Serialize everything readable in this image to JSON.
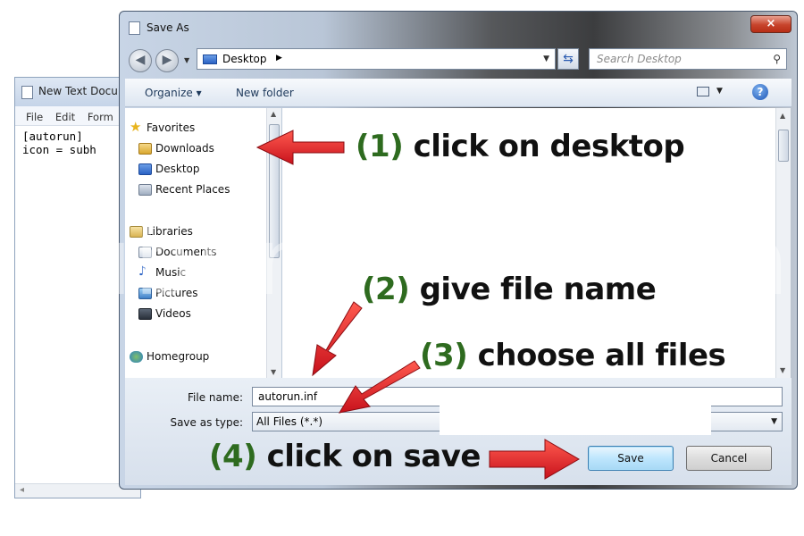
{
  "notepad": {
    "title": "New Text Docu",
    "menu": [
      "File",
      "Edit",
      "Form"
    ],
    "content": "[autorun]\nicon = subh"
  },
  "dialog": {
    "title": "Save As",
    "close_symbol": "×",
    "address": "Desktop",
    "search_placeholder": "Search Desktop",
    "toolbar": {
      "organize": "Organize ▾",
      "new_folder": "New folder",
      "help": "?"
    },
    "nav": {
      "favorites": "Favorites",
      "downloads": "Downloads",
      "desktop": "Desktop",
      "recent_places": "Recent Places",
      "libraries": "Libraries",
      "documents": "Documents",
      "music": "Music",
      "pictures": "Pictures",
      "videos": "Videos",
      "homegroup": "Homegroup"
    },
    "form": {
      "file_name_label": "File name:",
      "file_name_value": "autorun.inf",
      "save_type_label": "Save as type:",
      "save_type_value": "All Files  (*.*)"
    },
    "buttons": {
      "save": "Save",
      "cancel": "Cancel"
    }
  },
  "watermark": "subhrasom.com",
  "annotations": {
    "step1": {
      "num": "(1)",
      "text": " click on desktop"
    },
    "step2": {
      "num": "(2)",
      "text": " give file name"
    },
    "step3": {
      "num": "(3)",
      "text": " choose all files"
    },
    "step4": {
      "num": "(4)",
      "text": " click on save"
    }
  },
  "colors": {
    "annotation_number": "#2e6b1f",
    "arrow": "#e0252b",
    "save_button": "#bee6fd"
  },
  "icons": [
    "close-icon",
    "back-icon",
    "forward-icon",
    "refresh-icon",
    "search-icon",
    "views-icon",
    "help-icon",
    "star-icon",
    "folder-icon",
    "library-icon",
    "music-icon",
    "pictures-icon",
    "videos-icon",
    "homegroup-icon",
    "arrow-icon"
  ]
}
